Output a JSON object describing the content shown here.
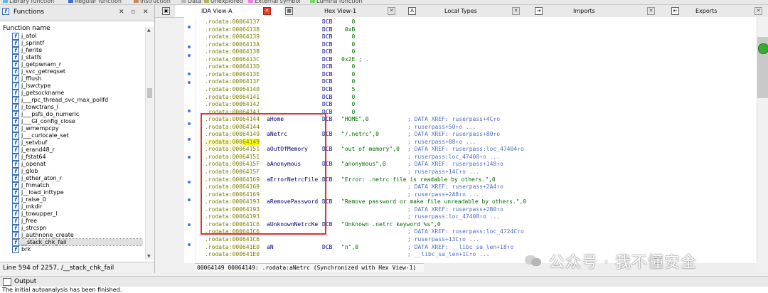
{
  "legend": [
    {
      "label": "Library function",
      "color": "#5bb8f0"
    },
    {
      "label": "Regular function",
      "color": "#3f6fd0"
    },
    {
      "label": "Instruction",
      "color": "#c98a5a"
    },
    {
      "label": "Data",
      "color": "#b8b8b8"
    },
    {
      "label": "Unexplored",
      "color": "#b6b060"
    },
    {
      "label": "External symbol",
      "color": "#f07ee8"
    },
    {
      "label": "Lumina function",
      "color": "#7cd86c"
    }
  ],
  "functions_panel": {
    "title": "Functions",
    "column_header": "Function name",
    "items": [
      "j_atol",
      "j_sprintf",
      "j_fwrite",
      "j_statfs",
      "j_getpwnam_r",
      "j_svc_getreqset",
      "j_fflush",
      "j_iswctype",
      "j_getsockname",
      "j___rpc_thread_svc_max_pollfd",
      "j_towctrans_l",
      "j___psfs_do_numeric",
      "j___GI_config_close",
      "j_wmempcpy",
      "j___curlocale_set",
      "j_setvbuf",
      "j_erand48_r",
      "j_fstat64",
      "j_openat",
      "j_glob",
      "j_ether_aton_r",
      "j_fnmatch",
      "j__load_inttype",
      "j_raise_0",
      "j_mkdir",
      "j_towupper_l",
      "j_free",
      "j_strcspn",
      "j_authnone_create",
      "__stack_chk_fail",
      "brk"
    ],
    "selected_index": 29,
    "status": "Line 594 of 2257, /__stack_chk_fail"
  },
  "tabs": [
    {
      "label": "IDA View-A",
      "active": true,
      "icon": "ida-view-icon"
    },
    {
      "label": "Hex View-1",
      "active": false,
      "icon": "hex-view-icon"
    },
    {
      "label": "Local Types",
      "active": false,
      "icon": "local-types-icon"
    },
    {
      "label": "Imports",
      "active": false,
      "icon": "imports-icon"
    },
    {
      "label": "Exports",
      "active": false,
      "icon": "exports-icon"
    }
  ],
  "code_lines": [
    {
      "addr": ".rodata:00064137",
      "label": "",
      "op": "DCB",
      "arg": "   0",
      "comment": ""
    },
    {
      "addr": ".rodata:00064138",
      "label": "",
      "op": "DCB",
      "arg": " 0xB",
      "comment": ""
    },
    {
      "addr": ".rodata:00064139",
      "label": "",
      "op": "DCB",
      "arg": "   0",
      "comment": ""
    },
    {
      "addr": ".rodata:0006413A",
      "label": "",
      "op": "DCB",
      "arg": "   0",
      "comment": ""
    },
    {
      "addr": ".rodata:0006413B",
      "label": "",
      "op": "DCB",
      "arg": "   0",
      "comment": ""
    },
    {
      "addr": ".rodata:0006413C",
      "label": "",
      "op": "DCB",
      "arg": "0x2E ; .",
      "comment": ""
    },
    {
      "addr": ".rodata:0006413D",
      "label": "",
      "op": "DCB",
      "arg": "   0",
      "comment": ""
    },
    {
      "addr": ".rodata:0006413E",
      "label": "",
      "op": "DCB",
      "arg": "   0",
      "comment": ""
    },
    {
      "addr": ".rodata:0006413F",
      "label": "",
      "op": "DCB",
      "arg": "   0",
      "comment": ""
    },
    {
      "addr": ".rodata:00064140",
      "label": "",
      "op": "DCB",
      "arg": "   5",
      "comment": ""
    },
    {
      "addr": ".rodata:00064141",
      "label": "",
      "op": "DCB",
      "arg": "   0",
      "comment": ""
    },
    {
      "addr": ".rodata:00064142",
      "label": "",
      "op": "DCB",
      "arg": "   0",
      "comment": ""
    },
    {
      "addr": ".rodata:00064143",
      "label": "",
      "op": "DCB",
      "arg": "   0",
      "comment": ""
    },
    {
      "addr": ".rodata:00064144",
      "label": "aHome",
      "op": "DCB",
      "arg": "\"HOME\",0",
      "comment": "; DATA XREF: ruserpass+4C↑o"
    },
    {
      "addr": ".rodata:00064144",
      "label": "",
      "op": "",
      "arg": "",
      "comment": "; ruserpass+50↑o ..."
    },
    {
      "addr": ".rodata:00064149",
      "label": "aNetrc",
      "op": "DCB",
      "arg": "\"/.netrc\",0",
      "comment": "; DATA XREF: ruserpass+80↑o"
    },
    {
      "addr": ".rodata:00064149",
      "label": "",
      "op": "",
      "arg": "",
      "comment": "; ruserpass+88↑o ..."
    },
    {
      "addr": ".rodata:00064151",
      "label": "aOutOfMemory",
      "op": "DCB",
      "arg": "\"out of memory\",0",
      "comment": "; DATA XREF: ruserpass:loc_47404↑o"
    },
    {
      "addr": ".rodata:00064151",
      "label": "",
      "op": "",
      "arg": "",
      "comment": "; ruserpass:loc_47408↑o ..."
    },
    {
      "addr": ".rodata:0006415F",
      "label": "aAnonymous",
      "op": "DCB",
      "arg": "\"anonymous\",0",
      "comment": "; DATA XREF: ruserpass+148↑o"
    },
    {
      "addr": ".rodata:0006415F",
      "label": "",
      "op": "",
      "arg": "",
      "comment": "; ruserpass+14C↑o ..."
    },
    {
      "addr": ".rodata:00064169",
      "label": "aErrorNetrcFile",
      "op": "DCB",
      "arg": "\"Error: .netrc file is readable by others.\",0",
      "comment": ""
    },
    {
      "addr": ".rodata:00064169",
      "label": "",
      "op": "",
      "arg": "",
      "comment": "; DATA XREF: ruserpass+2A4↑o"
    },
    {
      "addr": ".rodata:00064169",
      "label": "",
      "op": "",
      "arg": "",
      "comment": "; ruserpass+2A8↑o ..."
    },
    {
      "addr": ".rodata:00064193",
      "label": "aRemovePassword",
      "op": "DCB",
      "arg": "\"Remove password or make file unreadable by others.\",0",
      "comment": ""
    },
    {
      "addr": ".rodata:00064193",
      "label": "",
      "op": "",
      "arg": "",
      "comment": "; DATA XREF: ruserpass+2B0↑o"
    },
    {
      "addr": ".rodata:00064193",
      "label": "",
      "op": "",
      "arg": "",
      "comment": "; ruserpass:loc_47408↑o ..."
    },
    {
      "addr": ".rodata:000641C6",
      "label": "aUnknownNetrcKe",
      "op": "DCB",
      "arg": "\"Unknown .netrc keyword %s\",0",
      "comment": ""
    },
    {
      "addr": ".rodata:000641C6",
      "label": "",
      "op": "",
      "arg": "",
      "comment": "; DATA XREF: ruserpass:loc_4724C↑o"
    },
    {
      "addr": ".rodata:000641C6",
      "label": "",
      "op": "",
      "arg": "",
      "comment": "; ruserpass+13C↑o ..."
    },
    {
      "addr": ".rodata:000641E0",
      "label": "aN",
      "op": "DCB",
      "arg": "\"n\",0",
      "comment": "; DATA XREF: __libc_sa_len+18↑o"
    },
    {
      "addr": ".rodata:000641E0",
      "label": "",
      "op": "",
      "arg": "",
      "comment": "; __libc_sa_len+1C↑o ..."
    }
  ],
  "current_line_index": 16,
  "cursor_highlight_text": "64149",
  "code_status": "00064149 00064149: .rodata:aNetrc (Synchronized with Hex View-1)",
  "output": {
    "title": "Output",
    "body": "The initial autoanalysis has been finished."
  },
  "watermark": "公众号 · 我不懂安全"
}
